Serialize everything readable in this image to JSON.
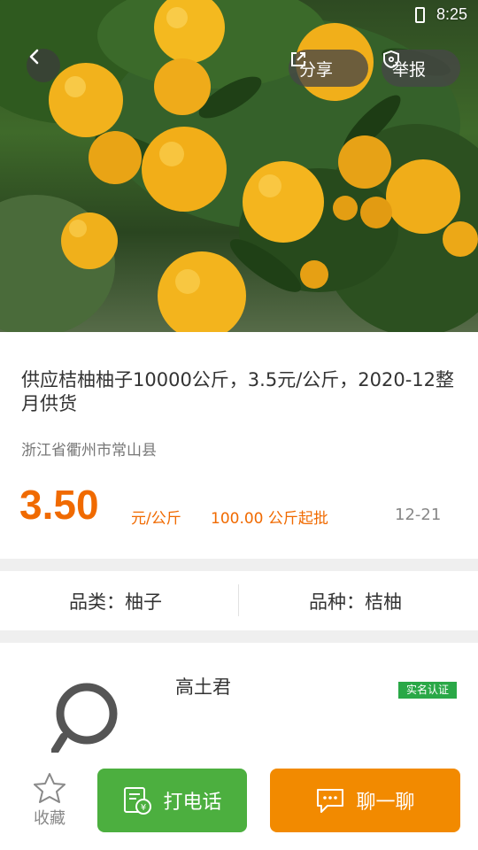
{
  "status_bar": {
    "time": "8:25"
  },
  "header": {
    "back_icon": "chevron-left-icon",
    "share_label": "分享",
    "share_icon": "share-icon",
    "report_label": "举报",
    "report_icon": "shield-icon"
  },
  "product": {
    "title": "供应桔柚柚子10000公斤，3.5元/公斤，2020-12整月供货",
    "location": "浙江省衢州市常山县",
    "price": "3.50",
    "unit": "元/公斤",
    "min_order": "100.00 公斤起批",
    "date": "12-21",
    "category": "品类：柚子",
    "variety": "品种：桔柚"
  },
  "seller": {
    "name": "高土君",
    "verified_label": "实名认证"
  },
  "bottom_bar": {
    "favorite_label": "收藏",
    "call_label": "打电话",
    "chat_label": "聊一聊"
  },
  "colors": {
    "accent_orange": "#f06a00",
    "call_green": "#4caf3f",
    "chat_orange": "#f28a00",
    "verified_green": "#2aa847"
  }
}
